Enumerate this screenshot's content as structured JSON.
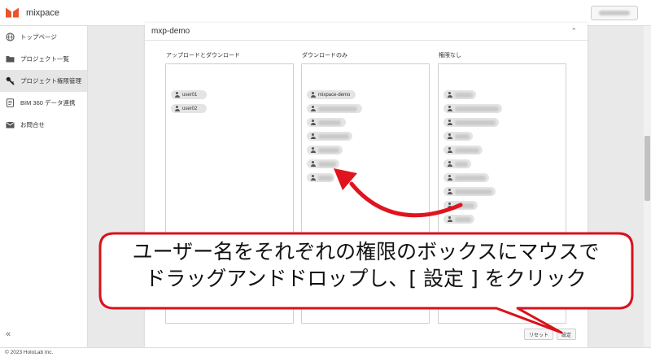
{
  "header": {
    "app_title": "mixpace"
  },
  "sidebar": {
    "items": [
      {
        "label": "トップページ",
        "icon": "globe-icon",
        "active": false
      },
      {
        "label": "プロジェクト一覧",
        "icon": "folder-icon",
        "active": false
      },
      {
        "label": "プロジェクト権限管理",
        "icon": "key-icon",
        "active": true
      },
      {
        "label": "BIM 360 データ連携",
        "icon": "bim360-icon",
        "active": false
      },
      {
        "label": "お問合せ",
        "icon": "mail-icon",
        "active": false
      }
    ],
    "collapse_label": "«"
  },
  "footer": {
    "copyright": "© 2023 HoloLab Inc."
  },
  "panel": {
    "title": "mxp-demo",
    "columns": {
      "upload": {
        "label": "アップロードとダウンロード",
        "users": [
          "user01",
          "user02"
        ]
      },
      "download": {
        "label": "ダウンロードのみ",
        "users": [
          "mixpace-demo"
        ]
      },
      "none": {
        "label": "権限なし"
      }
    },
    "reset_label": "リセット",
    "save_label": "設定"
  },
  "callout": {
    "line1": "ユーザー名をそれぞれの権限のボックスにマウスで",
    "line2": "ドラッグアンドドロップし、[ 設定 ] をクリック"
  },
  "colors": {
    "accent": "#e8542b",
    "callout_stroke": "#d8121b",
    "arrow": "#e0141f"
  }
}
